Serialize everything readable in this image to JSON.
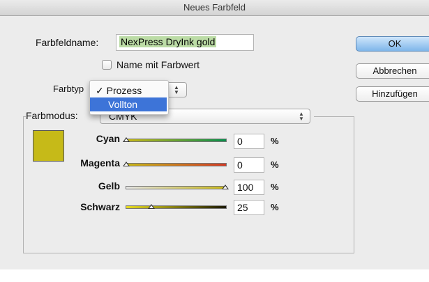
{
  "window": {
    "title": "Neues Farbfeld"
  },
  "form": {
    "name_label": "Farbfeldname:",
    "name_value": "NexPress DryInk gold",
    "checkbox_label": "Name mit Farbwert",
    "type_label": "Farbtyp",
    "type_options": [
      {
        "label": "✓ Prozess",
        "selected": false
      },
      {
        "label": "Vollton",
        "selected": true
      }
    ],
    "mode_label": "Farbmodus:",
    "mode_value": "CMYK"
  },
  "buttons": {
    "ok": "OK",
    "cancel": "Abbrechen",
    "add": "Hinzufügen"
  },
  "swatch_color": "#c6ba18",
  "sliders": [
    {
      "label": "Cyan",
      "value": "0",
      "unit": "%",
      "gradient": "linear-gradient(to right,#c8b818,#0a8f4c)"
    },
    {
      "label": "Magenta",
      "value": "0",
      "unit": "%",
      "gradient": "linear-gradient(to right,#c8b818,#d23a24)"
    },
    {
      "label": "Gelb",
      "value": "100",
      "unit": "%",
      "gradient": "linear-gradient(to right,#e6e6e6,#c8b818)"
    },
    {
      "label": "Schwarz",
      "value": "25",
      "unit": "%",
      "gradient": "linear-gradient(to right,#e8dc20,#1a1800)"
    }
  ]
}
